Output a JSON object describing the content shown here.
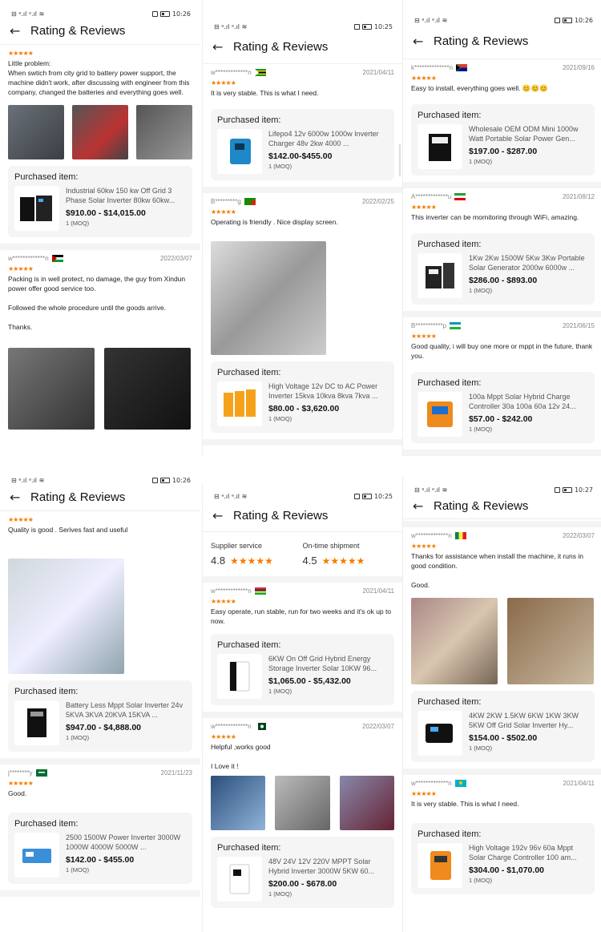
{
  "status": {
    "p1": "10:26",
    "p2": "10:25",
    "p3": "10:26",
    "p4": "10:26",
    "p5": "10:25",
    "p6": "10:27",
    "left_icons": "⊟ ᵃ.ıl ᵃ.ıl ≋"
  },
  "header": {
    "title": "Rating & Reviews",
    "back": "←"
  },
  "labels": {
    "purchased": "Purchased item:",
    "stars": "★★★★★",
    "moq": "1 (MOQ)"
  },
  "ratings": {
    "supplier_label": "Supplier service",
    "supplier_value": "4.8",
    "shipment_label": "On-time shipment",
    "shipment_value": "4.5",
    "stars": "★★★★★"
  },
  "p1": {
    "r1": {
      "text": "Little problem:\nWhen swtich from city grid to battery power support, the machine didn't work, after discussing with engineer from this company, changed the batteries and everything goes well.",
      "product": "Industrial 60kw 150 kw Off Grid 3 Phase Solar Inverter 80kw 60kw...",
      "price": "$910.00 - $14,015.00"
    },
    "r2": {
      "user": "w*************n",
      "date": "2022/03/07",
      "text": "Packing is in well protect, no damage, the guy from Xindun power offer good service too.\n\nFollowed the whole procedure until the goods arrive.\n\nThanks."
    }
  },
  "p2": {
    "r1": {
      "user": "w*************n",
      "date": "2021/04/11",
      "text": "It is very stable. This is what I need.",
      "product": "Lifepo4 12v 6000w 1000w Inverter Charger 48v 2kw 4000 ...",
      "price": "$142.00-$455.00"
    },
    "r2": {
      "user": "B*********g",
      "date": "2022/02/25",
      "text": "Operating is friendly . Nice display screen.",
      "product": "High Voltage 12v DC to AC Power Inverter 15kva 10kva 8kva 7kva ...",
      "price": "$80.00 - $3,620.00"
    }
  },
  "p3": {
    "r1": {
      "user": "k**************n",
      "date": "2021/09/16",
      "text": "Easy to install, everything goes well. 😊😊😊",
      "product": "Wholesale OEM ODM Mini 1000w Watt Portable Solar Power Gen...",
      "price": "$197.00 - $287.00"
    },
    "r2": {
      "user": "A*************u",
      "date": "2021/08/12",
      "text": "This inverter can be mornitoring through WiFi, amazing.",
      "product": "1Kw 2Kw 1500W 5Kw 3Kw Portable Solar Generator 2000w 6000w ...",
      "price": "$286.00 - $893.00"
    },
    "r3": {
      "user": "B***********p",
      "date": "2021/06/15",
      "text": "Good quality, i will buy one more or mppt in the future, thank you.",
      "product": "100a Mppt Solar Hybrid Charge Controller 30a 100a 60a 12v 24...",
      "price": "$57.00 - $242.00"
    }
  },
  "p4": {
    "r1": {
      "text": "Quality is good . Serives fast and useful",
      "product": "Battery Less Mppt Solar Inverter 24v 5KVA 3KVA 20KVA 15KVA ...",
      "price": "$947.00 - $4,888.00"
    },
    "r2": {
      "user": "j********y",
      "date": "2021/11/23",
      "text": "Good.",
      "product": "2500 1500W Power Inverter 3000W 1000W 4000W 5000W ...",
      "price": "$142.00 - $455.00"
    }
  },
  "p5": {
    "r1": {
      "user": "w*************n",
      "date": "2021/04/11",
      "text": "Easy operate, run stable, run for two weeks and it's ok up to now.",
      "product": "6KW On Off Grid Hybrid Energy Storage Inverter Solar 10KW 96...",
      "price": "$1,065.00 - $5,432.00"
    },
    "r2": {
      "user": "w*************n",
      "date": "2022/03/07",
      "text": "Helpful ,works good\n\nI Love it !",
      "product": "48V 24V 12V 220V MPPT Solar Hybrid Inverter 3000W 5KW 60...",
      "price": "$200.00 - $678.00"
    }
  },
  "p6": {
    "r1": {
      "user": "w*************n",
      "date": "2022/03/07",
      "text": "Thanks for assistance when install the machine, it runs in good condition.\n\nGood.",
      "product": "4KW 2KW 1.5KW 6KW 1KW 3KW 5KW Off Grid Solar Inverter Hy...",
      "price": "$154.00 - $502.00"
    },
    "r2": {
      "user": "w*************n",
      "date": "2021/04/11",
      "text": "It is very stable. This is what I need.",
      "product": "High Voltage 192v 96v 60a Mppt Solar Charge Controller 100 am...",
      "price": "$304.00 - $1,070.00"
    }
  },
  "colors": {
    "star": "#f57c00",
    "card_bg": "#f5f5f5"
  }
}
